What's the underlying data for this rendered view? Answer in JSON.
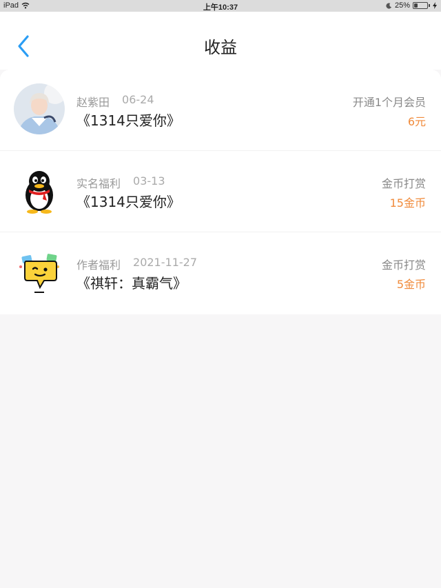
{
  "status_bar": {
    "device": "iPad",
    "time": "上午10:37",
    "battery": "25%",
    "battery_level": 0.25
  },
  "header": {
    "title": "收益"
  },
  "earnings": [
    {
      "name": "赵紫田",
      "date": "06-24",
      "book": "《1314只爱你》",
      "type": "开通1个月会员",
      "amount": "6元",
      "avatar_icon": "user-photo-avatar"
    },
    {
      "name": "实名福利",
      "date": "03-13",
      "book": "《1314只爱你》",
      "type": "金币打赏",
      "amount": "15金币",
      "avatar_icon": "penguin-avatar"
    },
    {
      "name": "作者福利",
      "date": "2021-11-27",
      "book": "《祺轩：真霸气》",
      "type": "金币打赏",
      "amount": "5金币",
      "avatar_icon": "wink-chat-bubble-avatar"
    }
  ],
  "colors": {
    "accent_blue": "#2a9df4",
    "amount_orange": "#f08a3a"
  }
}
